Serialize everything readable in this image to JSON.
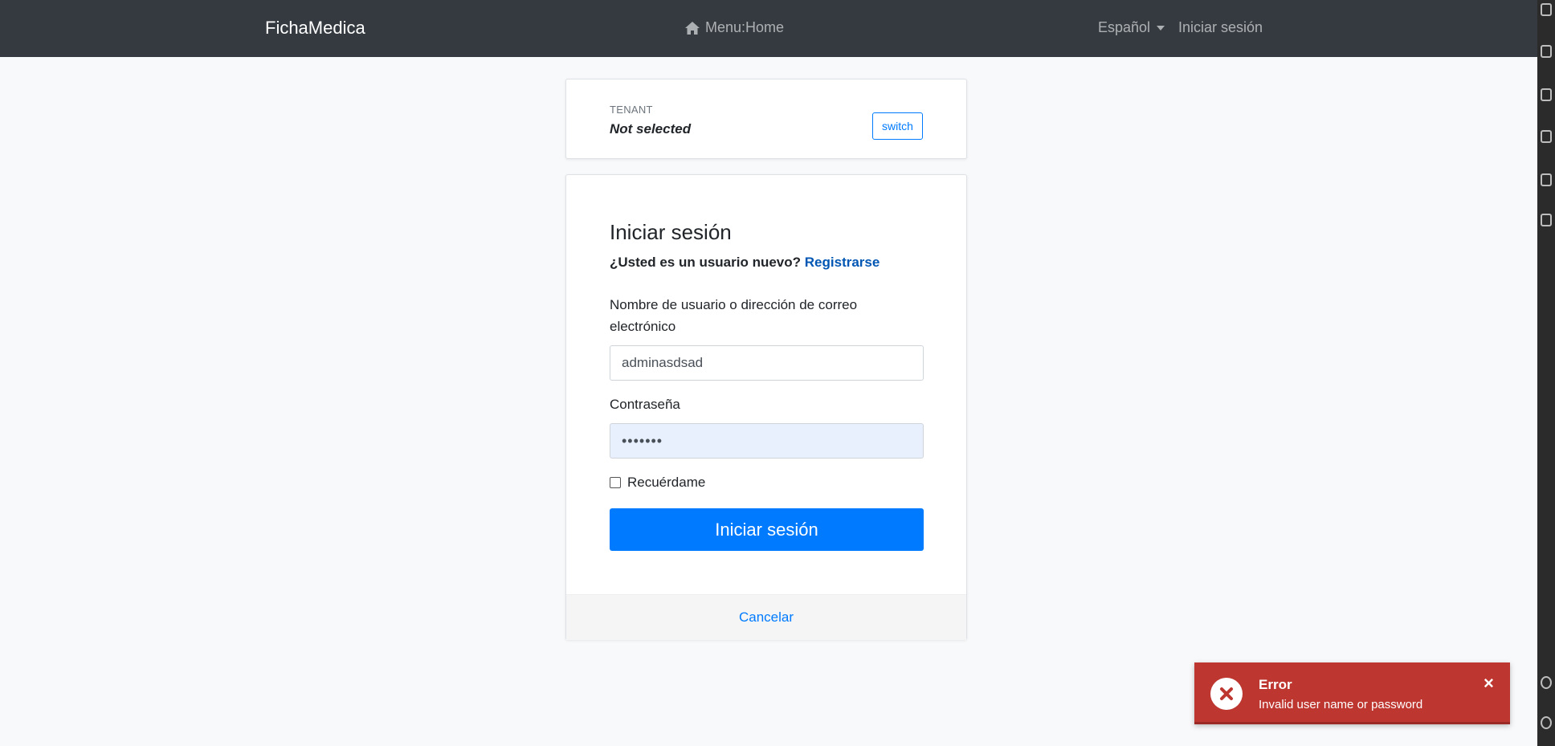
{
  "navbar": {
    "brand": "FichaMedica",
    "menu_label": "Menu:Home",
    "language": "Español",
    "login_link": "Iniciar sesión"
  },
  "tenant": {
    "label": "TENANT",
    "value": "Not selected",
    "switch_label": "switch"
  },
  "login": {
    "title": "Iniciar sesión",
    "new_user_prompt": "¿Usted es un usuario nuevo?",
    "register_link": "Registrarse",
    "username_label": "Nombre de usuario o dirección de correo electrónico",
    "username_value": "adminasdsad",
    "password_label": "Contraseña",
    "password_value": "•••••••",
    "remember_label": "Recuérdame",
    "remember_checked": false,
    "submit_label": "Iniciar sesión",
    "cancel_label": "Cancelar"
  },
  "toast": {
    "title": "Error",
    "message": "Invalid user name or password",
    "close_label": "×"
  },
  "colors": {
    "navbar_bg": "#343a40",
    "primary": "#007bff",
    "error": "#bd362f",
    "autofill_bg": "#e8f0fe"
  }
}
